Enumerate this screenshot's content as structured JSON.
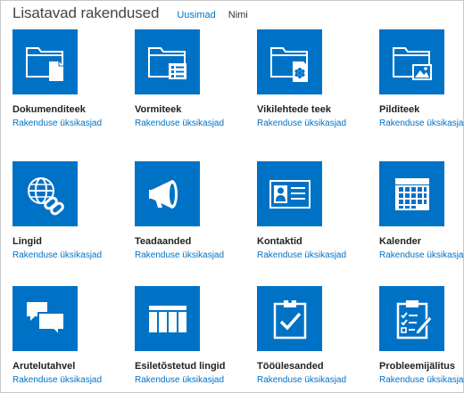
{
  "header": {
    "title": "Lisatavad rakendused",
    "sort_options": [
      "Uusimad",
      "Nimi"
    ]
  },
  "accent_color": "#0072c6",
  "apps": [
    {
      "name": "Dokumenditeek",
      "link": "Rakenduse üksikasjad",
      "icon": "document-library-icon"
    },
    {
      "name": "Vormiteek",
      "link": "Rakenduse üksikasjad",
      "icon": "form-library-icon"
    },
    {
      "name": "Vikilehtede teek",
      "link": "Rakenduse üksikasjad",
      "icon": "wiki-library-icon"
    },
    {
      "name": "Pilditeek",
      "link": "Rakenduse üksikasjad",
      "icon": "picture-library-icon"
    },
    {
      "name": "Lingid",
      "link": "Rakenduse üksikasjad",
      "icon": "links-icon"
    },
    {
      "name": "Teadaanded",
      "link": "Rakenduse üksikasjad",
      "icon": "announcements-icon"
    },
    {
      "name": "Kontaktid",
      "link": "Rakenduse üksikasjad",
      "icon": "contacts-icon"
    },
    {
      "name": "Kalender",
      "link": "Rakenduse üksikasjad",
      "icon": "calendar-icon"
    },
    {
      "name": "Arutelutahvel",
      "link": "Rakenduse üksikasjad",
      "icon": "discussion-board-icon"
    },
    {
      "name": "Esiletõstetud lingid",
      "link": "Rakenduse üksikasjad",
      "icon": "promoted-links-icon"
    },
    {
      "name": "Tööülesanded",
      "link": "Rakenduse üksikasjad",
      "icon": "tasks-icon"
    },
    {
      "name": "Probleemijälitus",
      "link": "Rakenduse üksikasjad",
      "icon": "issue-tracking-icon"
    }
  ]
}
